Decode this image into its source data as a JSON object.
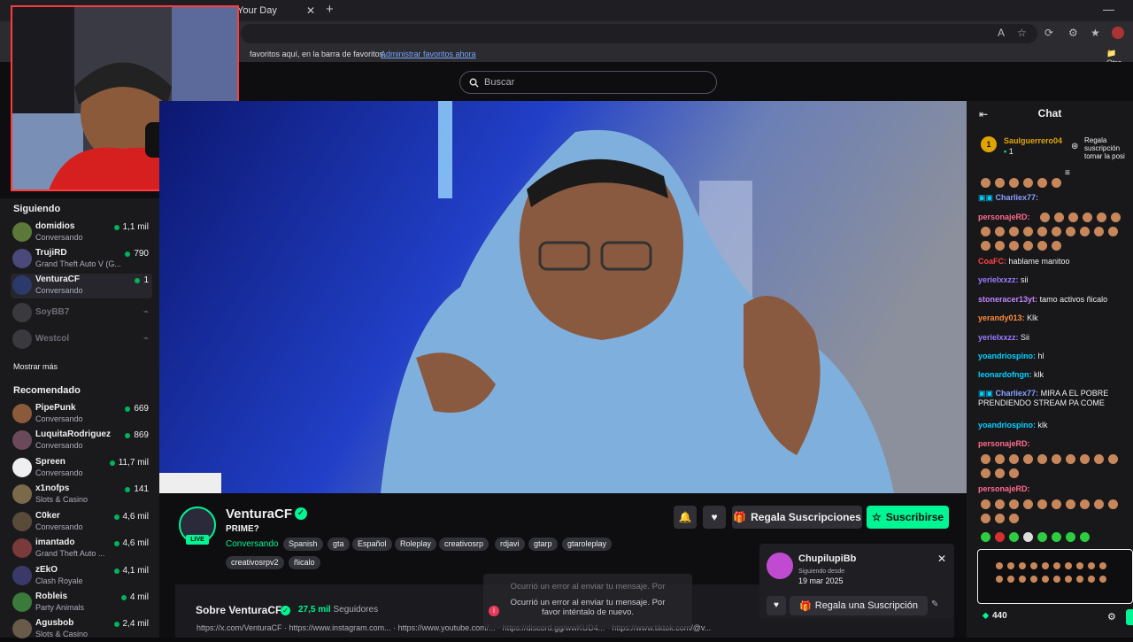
{
  "browser": {
    "tab_title": "Your Day",
    "tab_close": "✕",
    "new_tab": "+",
    "minimize": "—",
    "favorites_text": "favoritos aquí, en la barra de favoritos.",
    "favorites_link": "Administrar favoritos ahora",
    "favorites_other": "Otro"
  },
  "search": {
    "placeholder": "Buscar"
  },
  "sidebar": {
    "following_title": "Siguiendo",
    "following": [
      {
        "name": "domidios",
        "game": "Conversando",
        "viewers": "1,1 mil",
        "color": "#5b7a3a"
      },
      {
        "name": "TrujiRD",
        "game": "Grand Theft Auto V (G...",
        "viewers": "790",
        "color": "#4a4a7a"
      },
      {
        "name": "VenturaCF",
        "game": "Conversando",
        "viewers": "1",
        "color": "#2a3a6a"
      }
    ],
    "offline": [
      {
        "name": "SoyBB7"
      },
      {
        "name": "Westcol"
      }
    ],
    "show_more": "Mostrar más",
    "recommended_title": "Recomendado",
    "recommended": [
      {
        "name": "PipePunk",
        "game": "Conversando",
        "viewers": "669",
        "color": "#8a5a3a"
      },
      {
        "name": "LuquitaRodriguez",
        "game": "Conversando",
        "viewers": "869",
        "color": "#6a4a5a"
      },
      {
        "name": "Spreen",
        "game": "Conversando",
        "viewers": "11,7 mil",
        "color": "#efeff1"
      },
      {
        "name": "x1nofps",
        "game": "Slots & Casino",
        "viewers": "141",
        "color": "#7a6a4a"
      },
      {
        "name": "C0ker",
        "game": "Conversando",
        "viewers": "4,6 mil",
        "color": "#5a4a3a"
      },
      {
        "name": "imantado",
        "game": "Grand Theft Auto ...",
        "viewers": "4,6 mil",
        "color": "#7a3a3a"
      },
      {
        "name": "zEkO",
        "game": "Clash Royale",
        "viewers": "4,1 mil",
        "color": "#3a3a6a"
      },
      {
        "name": "Robleis",
        "game": "Party Animals",
        "viewers": "4 mil",
        "color": "#3a7a3a"
      },
      {
        "name": "Agusbob",
        "game": "Slots & Casino",
        "viewers": "2,4 mil",
        "color": "#6a5a4a"
      }
    ]
  },
  "stream": {
    "name": "VenturaCF",
    "title": "PRIME?",
    "category": "Conversando",
    "live": "LIVE",
    "tags": [
      "Spanish",
      "gta",
      "Español",
      "Roleplay",
      "creativosrp",
      "rdjavi",
      "gtarp",
      "gtaroleplay",
      "creativosrpv2",
      "ñicalo"
    ],
    "gift_label": "Regala Suscripciones",
    "subscribe_label": "Suscribirse",
    "about_title": "Sobre VenturaCF",
    "followers_count": "27,5 mil",
    "followers_label": "Seguidores",
    "links": [
      "https://x.com/VenturaCF",
      "https://www.instagram.com...",
      "https://www.youtube.com/...",
      "https://discord.gg/wwKUD4...",
      "https://www.tiktok.com/@v..."
    ]
  },
  "gift_popup": {
    "user": "ChupilupiBb",
    "since_label": "Siguiendo desde",
    "since_date": "19 mar 2025",
    "gift_button": "Regala una Suscripción"
  },
  "error": {
    "ghost": "Ocurrió un error al enviar tu mensaje. Por",
    "line1": "Ocurrió un error al enviar tu mensaje. Por",
    "line2": "favor inténtalo de nuevo."
  },
  "chat": {
    "title": "Chat",
    "pinned_user": "Saulguerrero04",
    "pinned_rank": "1",
    "pinned_count": "1",
    "pinned_text1": "Regala",
    "pinned_text2": "suscripción",
    "pinned_text3": "tomar la posi",
    "messages": [
      {
        "user": "Charliex77:",
        "text": "",
        "color": "#8aa0ff"
      },
      {
        "user": "personajeRD:",
        "text": "",
        "color": "#ff6b8b"
      },
      {
        "user": "CoaFC:",
        "text": "hablame manitoo",
        "color": "#ff4040"
      },
      {
        "user": "yerielxxzz:",
        "text": "sii",
        "color": "#9b7bff"
      },
      {
        "user": "stoneracer13yt:",
        "text": "tamo activos ñicalo",
        "color": "#c084fc"
      },
      {
        "user": "yerandy013:",
        "text": "Klk",
        "color": "#ff8c3a"
      },
      {
        "user": "yerielxxzz:",
        "text": "Sii",
        "color": "#9b7bff"
      },
      {
        "user": "yoandriospino:",
        "text": "hl",
        "color": "#00d2ff"
      },
      {
        "user": "leonardofngn:",
        "text": "klk",
        "color": "#00d2ff"
      },
      {
        "user": "Charliex77:",
        "text": "MIRA A EL POBRE PRENDIENDO STREAM PA COME",
        "color": "#8aa0ff"
      },
      {
        "user": "yoandriospino:",
        "text": "klk",
        "color": "#00d2ff"
      },
      {
        "user": "personajeRD:",
        "text": "",
        "color": "#ff6b8b"
      },
      {
        "user": "personajeRD:",
        "text": "",
        "color": "#ff6b8b"
      }
    ],
    "points": "440"
  },
  "colors": {
    "accent": "#00f593",
    "live_red": "#eb0400"
  }
}
